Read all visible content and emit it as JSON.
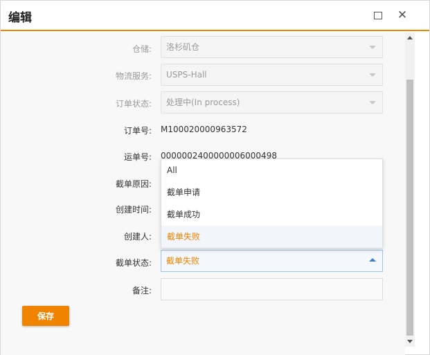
{
  "window": {
    "title": "编辑"
  },
  "form": {
    "warehouse": {
      "label": "仓储:",
      "value": "洛杉矶仓"
    },
    "logistics": {
      "label": "物流服务:",
      "value": "USPS-Hall"
    },
    "order_status": {
      "label": "订单状态:",
      "value": "处理中(In process)"
    },
    "order_no": {
      "label": "订单号:",
      "value": "M100020000963572"
    },
    "tracking_no": {
      "label": "运单号:",
      "value": "0000002400000006000498"
    },
    "intercept_reason": {
      "label": "截单原因:"
    },
    "created_time": {
      "label": "创建时间:"
    },
    "creator": {
      "label": "创建人:"
    },
    "intercept_status": {
      "label": "截单状态:",
      "value": "截单失败",
      "options": [
        "All",
        "截单申请",
        "截单成功",
        "截单失败"
      ],
      "selected_index": 3
    },
    "remark": {
      "label": "备注:",
      "value": ""
    }
  },
  "actions": {
    "save_label": "保存"
  },
  "colors": {
    "accent": "#f08300",
    "focus_border": "#9cc3e8"
  }
}
